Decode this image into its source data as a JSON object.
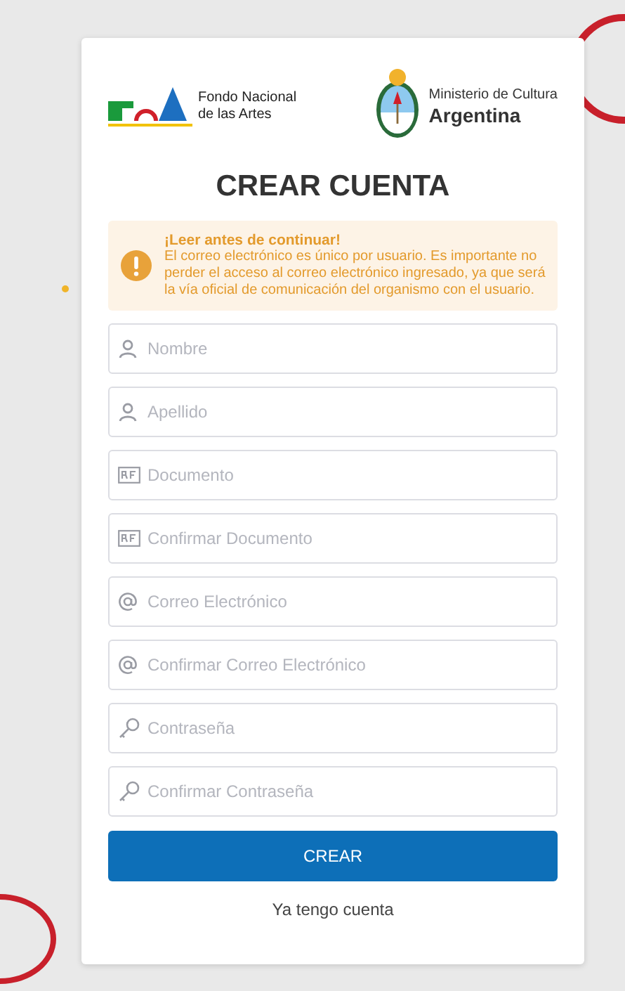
{
  "logos": {
    "fondo": {
      "line_1": "Fondo Nacional",
      "line_2": "de las Artes"
    },
    "ministerio": {
      "line_1": "Ministerio de Cultura",
      "line_2": "Argentina"
    }
  },
  "title": "CREAR CUENTA",
  "alert": {
    "heading": "¡Leer antes de continuar!",
    "body": "El correo electrónico es único por usuario. Es importante no perder el acceso al correo electrónico ingresado, ya que será la vía oficial de comunicación del organismo con el usuario."
  },
  "fields": [
    {
      "kind": "user",
      "placeholder": "Nombre"
    },
    {
      "kind": "user",
      "placeholder": "Apellido"
    },
    {
      "kind": "id",
      "placeholder": "Documento"
    },
    {
      "kind": "id",
      "placeholder": "Confirmar Documento"
    },
    {
      "kind": "email",
      "placeholder": "Correo Electrónico"
    },
    {
      "kind": "email",
      "placeholder": "Confirmar Correo Electrónico"
    },
    {
      "kind": "key",
      "placeholder": "Contraseña"
    },
    {
      "kind": "key",
      "placeholder": "Confirmar Contraseña"
    }
  ],
  "submit_button": "CREAR",
  "login_link": "Ya tengo cuenta"
}
